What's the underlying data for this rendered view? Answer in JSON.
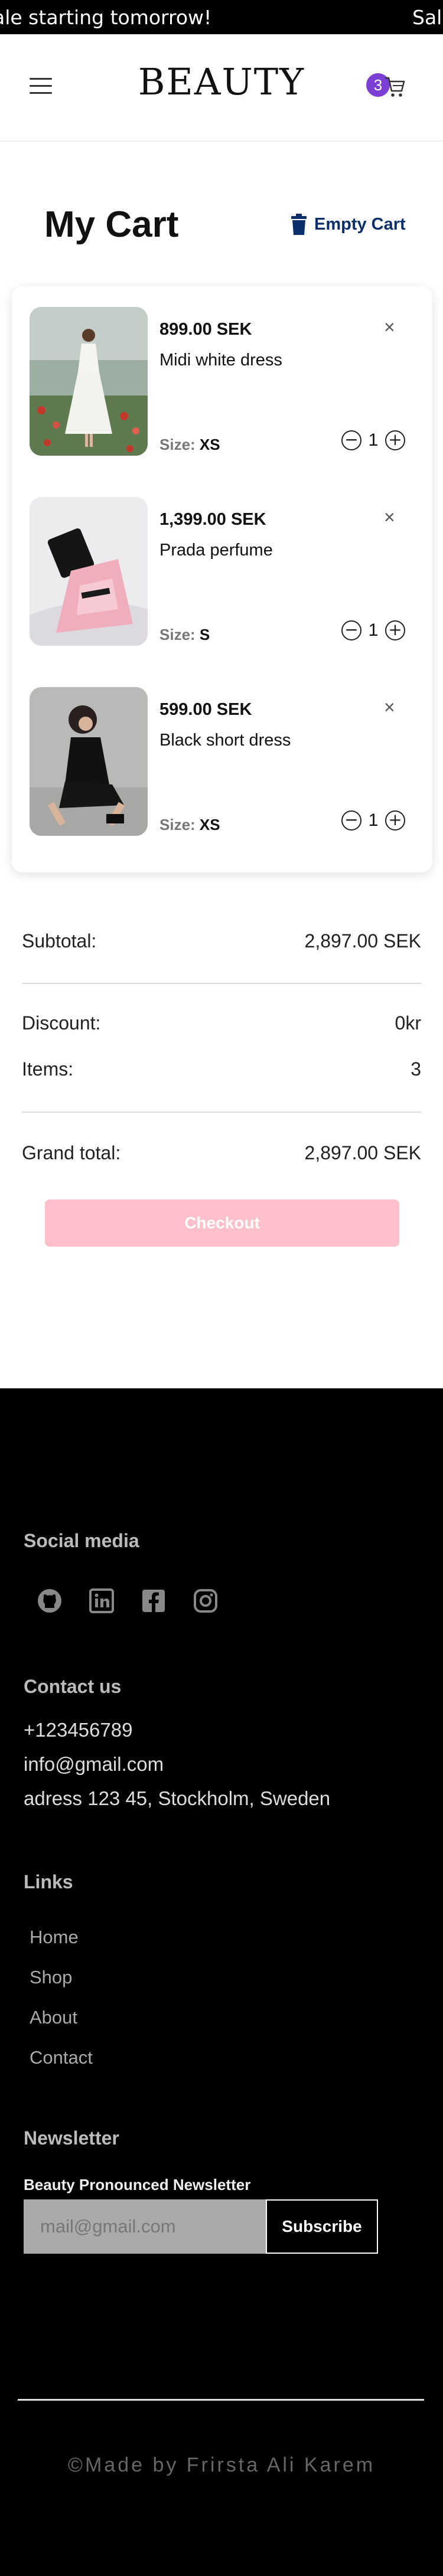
{
  "marquee": {
    "left_text": "ale starting tomorrow!",
    "right_text": "Sale"
  },
  "header": {
    "logo": "BEAUTY",
    "cart_count": "3",
    "icons": {
      "menu": "hamburger-menu-icon",
      "cart": "shopping-cart-icon"
    }
  },
  "cart": {
    "title": "My Cart",
    "empty_label": "Empty Cart",
    "size_label": "Size:",
    "remove_symbol": "×",
    "items": [
      {
        "price": "899.00 SEK",
        "name": "Midi white dress",
        "size": "XS",
        "qty": "1"
      },
      {
        "price": "1,399.00 SEK",
        "name": "Prada perfume",
        "size": "S",
        "qty": "1"
      },
      {
        "price": "599.00 SEK",
        "name": "Black short dress",
        "size": "XS",
        "qty": "1"
      }
    ]
  },
  "summary": {
    "subtotal_label": "Subtotal:",
    "subtotal_value": "2,897.00 SEK",
    "discount_label": "Discount:",
    "discount_value": "0kr",
    "items_label": "Items:",
    "items_value": "3",
    "grand_label": "Grand total:",
    "grand_value": "2,897.00 SEK",
    "checkout_label": "Checkout"
  },
  "footer": {
    "social_heading": "Social media",
    "social_icons": [
      "github-icon",
      "linkedin-icon",
      "facebook-icon",
      "instagram-icon"
    ],
    "contact_heading": "Contact us",
    "phone": "+123456789",
    "email": "info@gmail.com",
    "address": "adress 123 45, Stockholm, Sweden",
    "links_heading": "Links",
    "links": [
      "Home",
      "Shop",
      "About",
      "Contact"
    ],
    "newsletter_heading": "Newsletter",
    "newsletter_label": "Beauty Pronounced Newsletter",
    "newsletter_placeholder": "mail@gmail.com",
    "subscribe_label": "Subscribe",
    "copyright": "©Made by Frirsta Ali Karem"
  },
  "colors": {
    "accent": "#7b3fd4",
    "checkout": "#ffc0cb",
    "empty_cart": "#0b2f6b",
    "footer_bg": "#000000"
  }
}
